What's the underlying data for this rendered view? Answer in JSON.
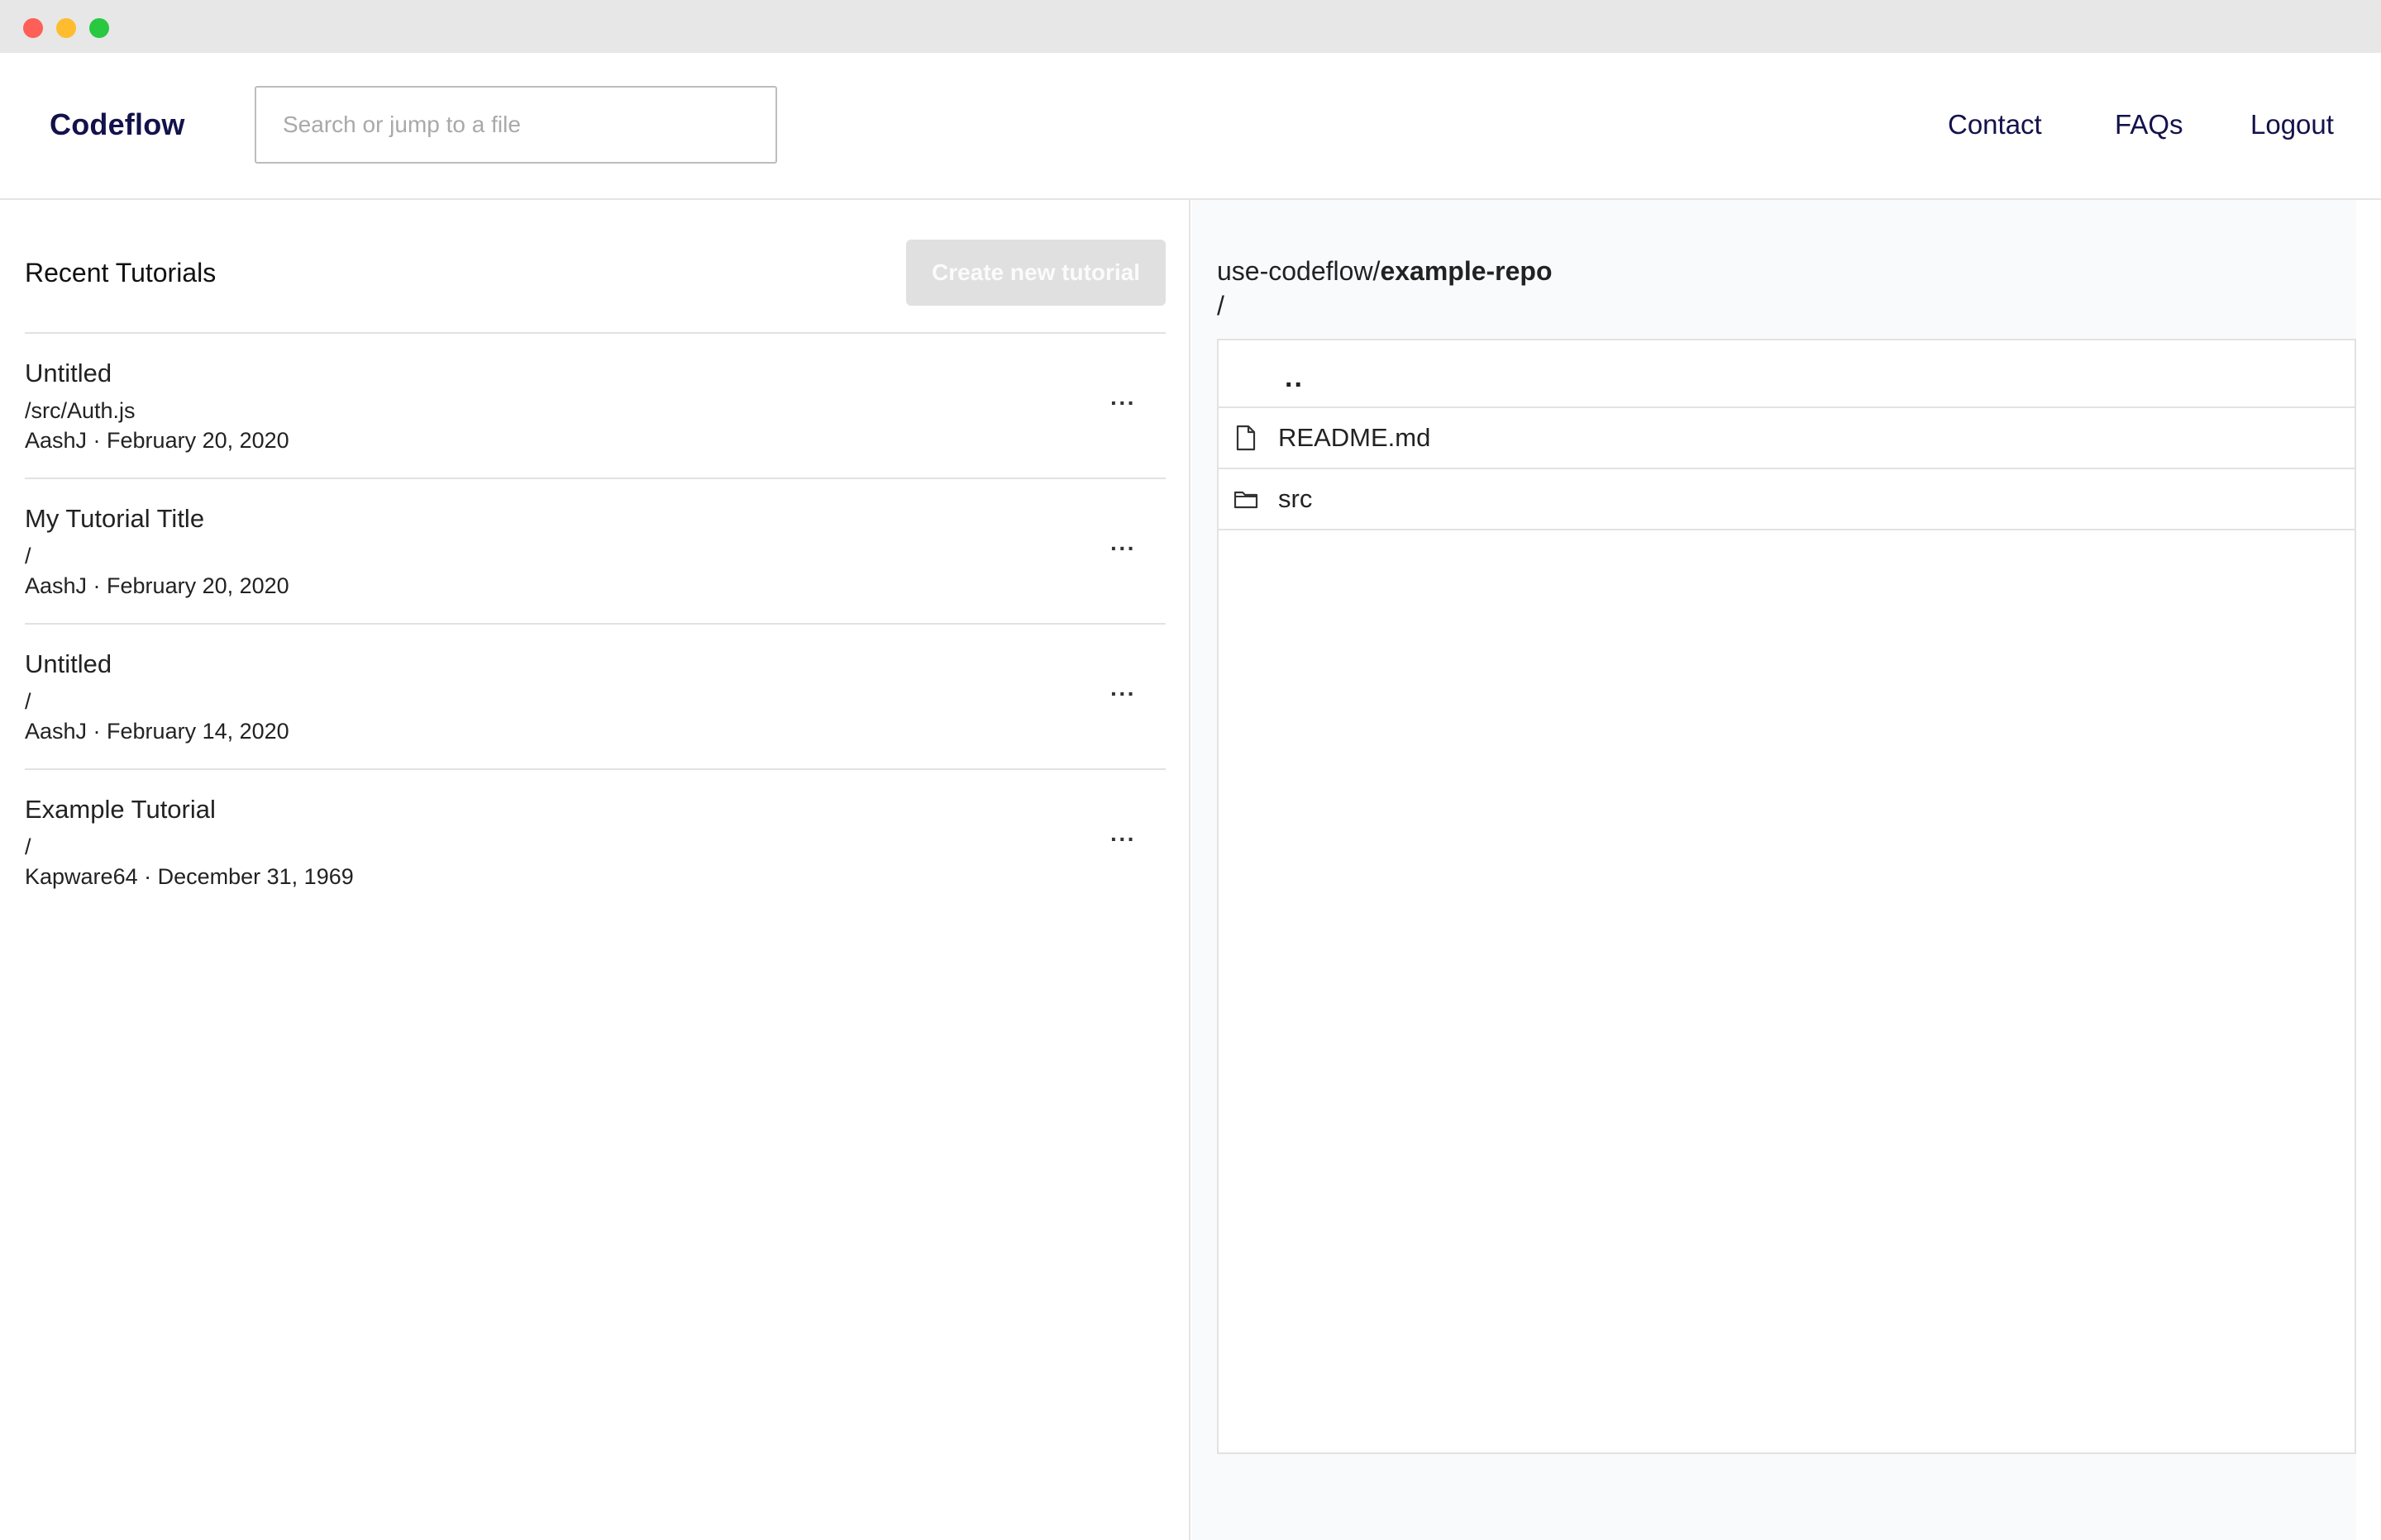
{
  "window": {
    "controls": [
      "close",
      "minimize",
      "maximize"
    ]
  },
  "header": {
    "brand": "Codeflow",
    "search_placeholder": "Search or jump to a file",
    "nav": {
      "contact": "Contact",
      "faqs": "FAQs",
      "logout": "Logout"
    }
  },
  "tutorials": {
    "title": "Recent Tutorials",
    "create_button": "Create new tutorial",
    "items": [
      {
        "title": "Untitled",
        "path": "/src/Auth.js",
        "meta": "AashJ · February 20, 2020",
        "menu": "···"
      },
      {
        "title": "My Tutorial Title",
        "path": "/",
        "meta": "AashJ · February 20, 2020",
        "menu": "···"
      },
      {
        "title": "Untitled",
        "path": "/",
        "meta": "AashJ · February 14, 2020",
        "menu": "···"
      },
      {
        "title": "Example Tutorial",
        "path": "/",
        "meta": "Kapware64 · December 31, 1969",
        "menu": "···"
      }
    ]
  },
  "repo": {
    "owner": "use-codeflow/",
    "name": "example-repo",
    "current_dir": "/",
    "parent_label": "..",
    "files": [
      {
        "name": "README.md",
        "icon": "file-icon"
      },
      {
        "name": "src",
        "icon": "folder-icon"
      }
    ]
  },
  "colors": {
    "brand": "#13124b",
    "disabled_button_bg": "#e0e0e0",
    "right_panel_bg": "#f9fafb"
  }
}
